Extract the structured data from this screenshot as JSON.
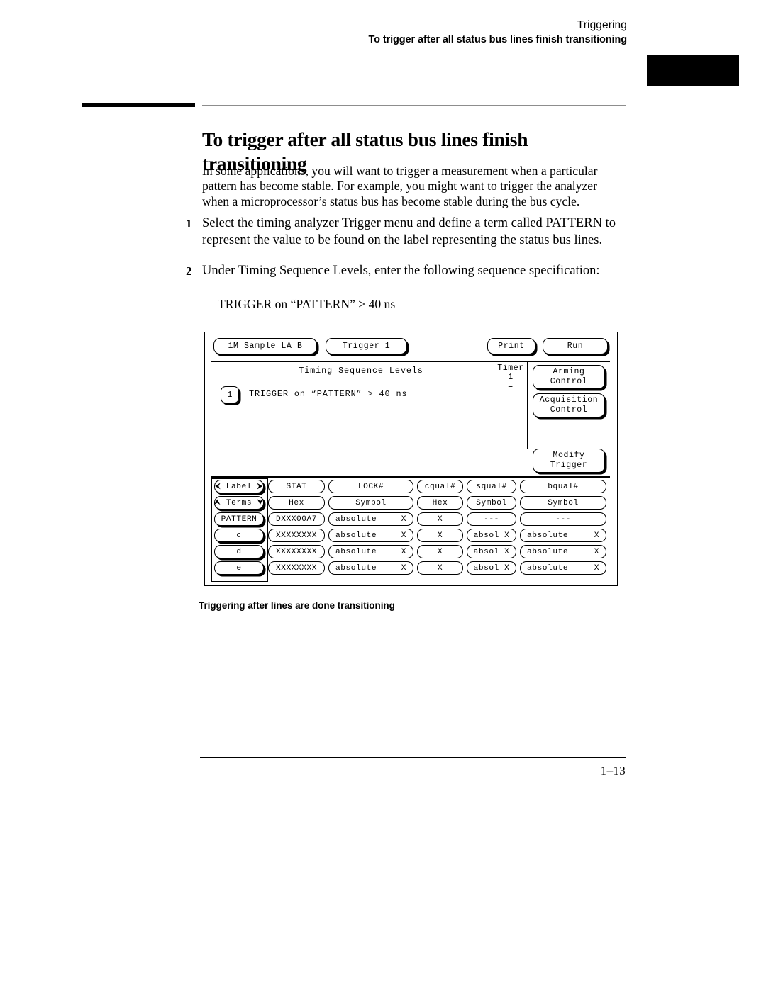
{
  "header": {
    "chapter": "Triggering",
    "section": "To trigger after all status bus lines finish transitioning"
  },
  "title": "To trigger after all status bus lines finish transitioning",
  "intro": "In some applications, you will want to trigger a measurement when a particular pattern has become stable. For example, you might want to trigger the analyzer when a microprocessor’s status bus has become stable during the bus cycle.",
  "steps": [
    {
      "num": "1",
      "text": "Select the timing analyzer Trigger menu and define a term called PATTERN to represent the value to be found on the label representing the status bus lines."
    },
    {
      "num": "2",
      "text": "Under Timing Sequence Levels, enter the following sequence specification:"
    }
  ],
  "spec_line": "TRIGGER on “PATTERN” > 40 ns",
  "screen": {
    "topbar": {
      "machine": "1M Sample LA B",
      "trigger": "Trigger 1",
      "print": "Print",
      "run": "Run"
    },
    "sequence": {
      "title": "Timing Sequence Levels",
      "timer_label": "Timer",
      "timer_num": "1",
      "timer_value": "–",
      "level_num": "1",
      "level_text": "TRIGGER on “PATTERN” > 40 ns"
    },
    "softkeys": {
      "arming_l1": "Arming",
      "arming_l2": "Control",
      "acquisition_l1": "Acquisition",
      "acquisition_l2": "Control",
      "modify_l1": "Modify",
      "modify_l2": "Trigger"
    },
    "grid": {
      "row_headers": [
        "⮜ Label ⮞",
        "⮝ Terms ⮟",
        "PATTERN",
        "c",
        "d",
        "e"
      ],
      "columns": [
        {
          "name": "STAT",
          "base": "Hex",
          "cells": [
            "DXXX00A7",
            "XXXXXXXX",
            "XXXXXXXX",
            "XXXXXXXX"
          ]
        },
        {
          "name": "LOCK#",
          "base": "Symbol",
          "cells": [
            "absolute|X",
            "absolute|X",
            "absolute|X",
            "absolute|X"
          ]
        },
        {
          "name": "cqual#",
          "base": "Hex",
          "cells": [
            "X",
            "X",
            "X",
            "X"
          ]
        },
        {
          "name": "squal#",
          "base": "Symbol",
          "cells": [
            "---",
            "absol X",
            "absol X",
            "absol X"
          ]
        },
        {
          "name": "bqual#",
          "base": "Symbol",
          "cells": [
            "---",
            "absolute|X",
            "absolute|X",
            "absolute|X"
          ]
        }
      ]
    }
  },
  "figure_caption": "Triggering after lines are done transitioning",
  "page_number": "1–13"
}
